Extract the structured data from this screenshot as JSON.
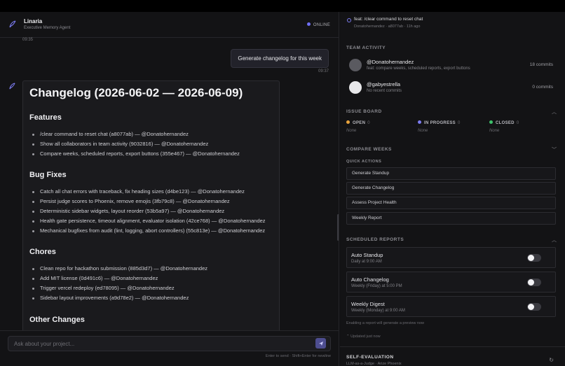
{
  "agent": {
    "name": "Linaria",
    "subtitle": "Executive Memory Agent",
    "status": "ONLINE"
  },
  "chat": {
    "timestamp_top": "09:35",
    "user_message": "Generate changelog for this week",
    "user_timestamp": "09:37",
    "changelog": {
      "title": "Changelog (2026-06-02 — 2026-06-09)",
      "sections": [
        {
          "heading": "Features",
          "items": [
            "/clear command to reset chat (a8077ab) — @Donatohernandez",
            "Show all collaborators in team activity (9032816) — @Donatohernandez",
            "Compare weeks, scheduled reports, export buttons (355e467) — @Donatohernandez"
          ]
        },
        {
          "heading": "Bug Fixes",
          "items": [
            "Catch all chat errors with traceback, fix heading sizes (d4be123) — @Donatohernandez",
            "Persist judge scores to Phoenix, remove emojis (3fb79c8) — @Donatohernandez",
            "Deterministic sidebar widgets, layout reorder (53b5a97) — @Donatohernandez",
            "Health gate persistence, timeout alignment, evaluator isolation (42ce768) — @Donatohernandez",
            "Mechanical bugfixes from audit (lint, logging, abort controllers) (55c813e) — @Donatohernandez"
          ]
        },
        {
          "heading": "Chores",
          "items": [
            "Clean repo for hackathon submission (885d3d7) — @Donatohernandez",
            "Add MIT license (0d491c6) — @Donatohernandez",
            "Trigger vercel redeploy (ed78095) — @Donatohernandez",
            "Sidebar layout improvements (a9d78e2) — @Donatohernandez"
          ]
        }
      ],
      "partial_next_heading": "Other Changes"
    },
    "input_placeholder": "Ask about your project...",
    "input_hint": "Enter to send · Shift+Enter for newline"
  },
  "sidebar": {
    "latest_commit": {
      "title": "feat: /clear command to reset chat",
      "meta": "Donatohernandez · a8077ab · 11h ago"
    },
    "team_activity": {
      "title": "TEAM ACTIVITY",
      "members": [
        {
          "name": "@Donatohernandez",
          "summary": "feat: compare weeks, scheduled reports, export buttons",
          "commits": "18 commits"
        },
        {
          "name": "@gabyestrella",
          "summary": "No recent commits",
          "commits": "0 commits"
        }
      ]
    },
    "issue_board": {
      "title": "ISSUE BOARD",
      "columns": [
        {
          "label": "OPEN",
          "count": "0",
          "empty": "None",
          "color": "#e8a33d"
        },
        {
          "label": "IN PROGRESS",
          "count": "0",
          "empty": "None",
          "color": "#7c7cf0"
        },
        {
          "label": "CLOSED",
          "count": "0",
          "empty": "None",
          "color": "#3dbf6a"
        }
      ]
    },
    "compare_weeks": {
      "title": "COMPARE WEEKS"
    },
    "quick_actions": {
      "title": "QUICK ACTIONS",
      "actions": [
        "Generate Standup",
        "Generate Changelog",
        "Assess Project Health",
        "Weekly Report"
      ]
    },
    "scheduled_reports": {
      "title": "SCHEDULED REPORTS",
      "reports": [
        {
          "name": "Auto Standup",
          "schedule": "Daily at 9:00 AM"
        },
        {
          "name": "Auto Changelog",
          "schedule": "Weekly (Friday) at 5:00 PM"
        },
        {
          "name": "Weekly Digest",
          "schedule": "Weekly (Monday) at 9:00 AM"
        }
      ],
      "note": "Enabling a report will generate a preview now",
      "updated": "Updated just now"
    },
    "self_evaluation": {
      "title": "SELF-EVALUATION",
      "subtitle": "LLM-as-a-Judge · Arize Phoenix"
    }
  }
}
